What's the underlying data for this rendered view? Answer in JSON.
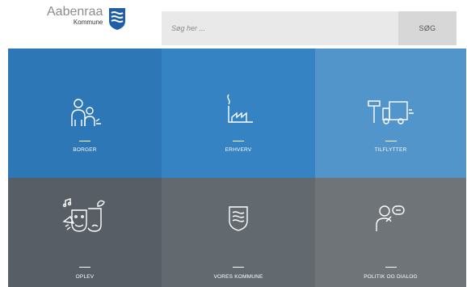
{
  "logo": {
    "name": "Aabenraa",
    "sub": "Kommune"
  },
  "search": {
    "placeholder": "Søg her ...",
    "button_label": "SØG"
  },
  "tiles": [
    {
      "label": "BORGER"
    },
    {
      "label": "ERHVERV"
    },
    {
      "label": "TILFLYTTER"
    },
    {
      "label": "OPLEV"
    },
    {
      "label": "VORES KOMMUNE"
    },
    {
      "label": "POLITIK OG DIALOG"
    }
  ],
  "colors": {
    "tile_blue_1": "#2d77b6",
    "tile_blue_2": "#3583c2",
    "tile_blue_3": "#5295ca",
    "tile_grey_1": "#575e65",
    "tile_grey_2": "#626a70",
    "tile_grey_3": "#6e7478",
    "shield": "#1f5fa8"
  }
}
